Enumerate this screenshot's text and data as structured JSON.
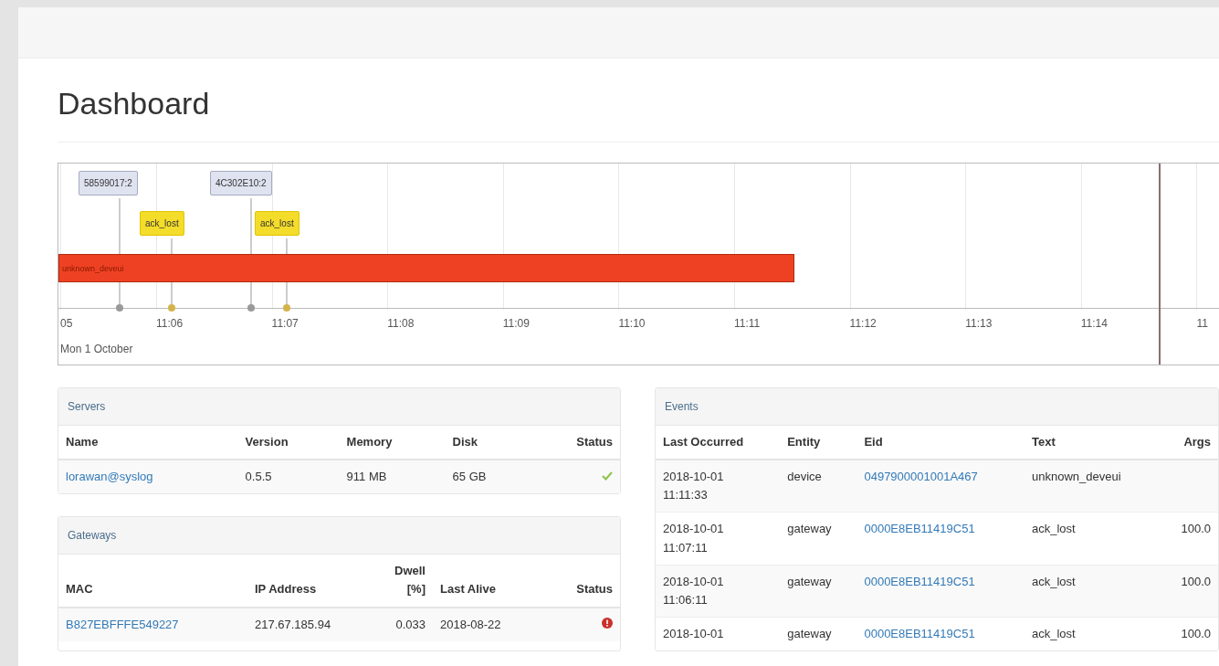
{
  "page": {
    "title": "Dashboard"
  },
  "timeline": {
    "ticks": [
      "05",
      "11:06",
      "11:07",
      "11:08",
      "11:09",
      "11:10",
      "11:11",
      "11:12",
      "11:13",
      "11:14",
      "11"
    ],
    "date": "Mon 1 October",
    "items": [
      {
        "kind": "box",
        "label": "58599017:2"
      },
      {
        "kind": "warning",
        "label": "ack_lost"
      },
      {
        "kind": "box",
        "label": "4C302E10:2"
      },
      {
        "kind": "warning",
        "label": "ack_lost"
      }
    ],
    "bar": {
      "label": "unknown_deveui"
    }
  },
  "servers": {
    "title": "Servers",
    "columns": [
      "Name",
      "Version",
      "Memory",
      "Disk",
      "Status"
    ],
    "rows": [
      {
        "name": "lorawan@syslog",
        "version": "0.5.5",
        "memory": "911 MB",
        "disk": "65 GB",
        "online": true
      }
    ]
  },
  "gateways": {
    "title": "Gateways",
    "columns": [
      "MAC",
      "IP Address",
      "Dwell [%]",
      "Last Alive",
      "Status"
    ],
    "rows": [
      {
        "mac": "B827EBFFFE549227",
        "ip": "217.67.185.94",
        "dwell": "0.033",
        "last_alive": "2018-08-22",
        "online": false
      }
    ]
  },
  "events": {
    "title": "Events",
    "columns": [
      "Last Occurred",
      "Entity",
      "Eid",
      "Text",
      "Args"
    ],
    "rows": [
      {
        "occurred": [
          "2018-10-01",
          "11:11:33"
        ],
        "entity": "device",
        "eid": "0497900001001A467",
        "text": "unknown_deveui",
        "args": ""
      },
      {
        "occurred": [
          "2018-10-01",
          "11:07:11"
        ],
        "entity": "gateway",
        "eid": "0000E8EB11419C51",
        "text": "ack_lost",
        "args": "100.0"
      },
      {
        "occurred": [
          "2018-10-01",
          "11:06:11"
        ],
        "entity": "gateway",
        "eid": "0000E8EB11419C51",
        "text": "ack_lost",
        "args": "100.0"
      },
      {
        "occurred": [
          "2018-10-01"
        ],
        "entity": "gateway",
        "eid": "0000E8EB11419C51",
        "text": "ack_lost",
        "args": "100.0"
      }
    ]
  }
}
